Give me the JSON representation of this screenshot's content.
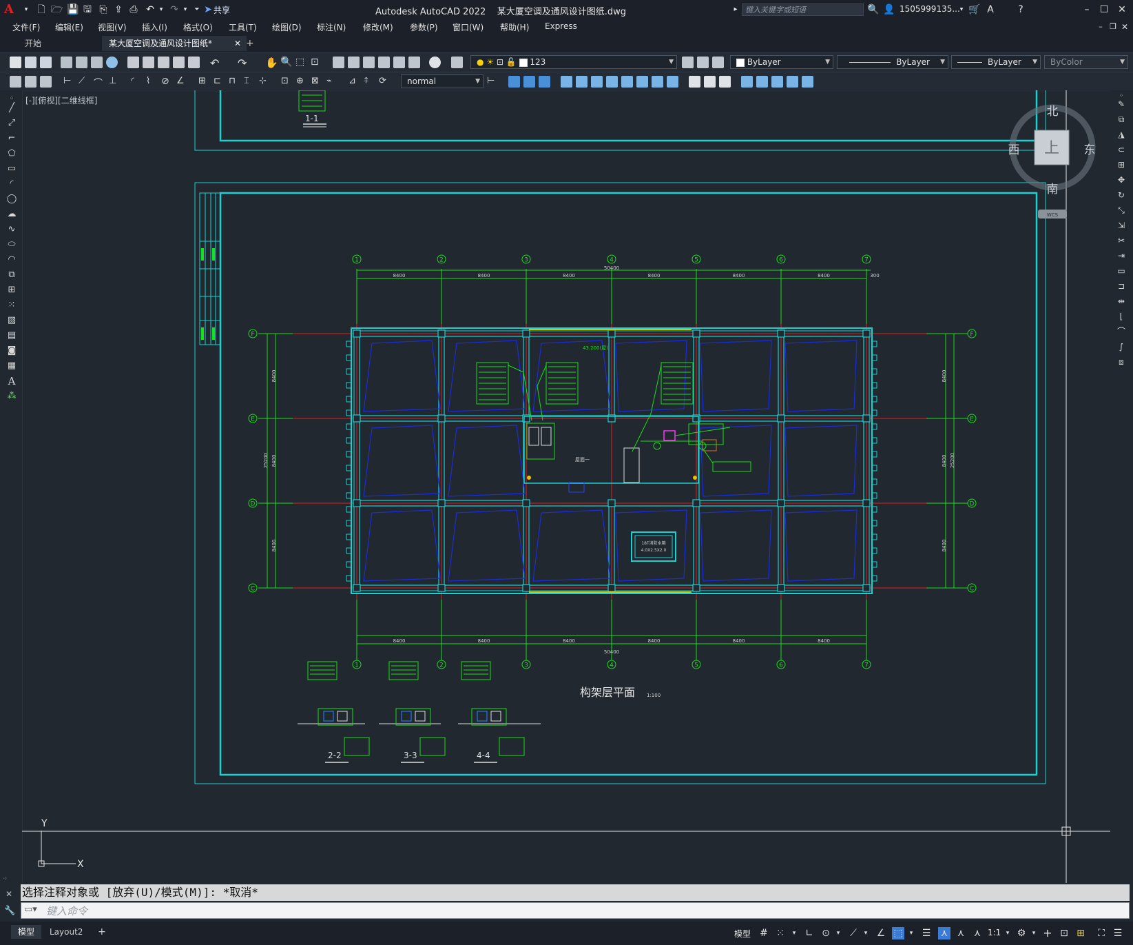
{
  "app": {
    "logo": "A",
    "title": "Autodesk AutoCAD 2022",
    "filename": "某大厦空调及通风设计图纸.dwg",
    "share_label": "共享",
    "search_placeholder": "键入关键字或短语",
    "user": "1505999135...",
    "help": "?"
  },
  "menu": [
    "文件(F)",
    "编辑(E)",
    "视图(V)",
    "插入(I)",
    "格式(O)",
    "工具(T)",
    "绘图(D)",
    "标注(N)",
    "修改(M)",
    "参数(P)",
    "窗口(W)",
    "帮助(H)",
    "Express"
  ],
  "tabs": {
    "start": "开始",
    "doc": "某大厦空调及通风设计图纸*",
    "close": "✕",
    "add": "+"
  },
  "properties": {
    "layer": "123",
    "color": "ByLayer",
    "linetype": "ByLayer",
    "lineweight": "ByLayer",
    "plotstyle": "ByColor",
    "textstyle": "normal"
  },
  "viewport_label": "[-][俯视][二维线框]",
  "viewcube": {
    "north": "北",
    "south": "南",
    "east": "东",
    "west": "西",
    "face": "上",
    "wcs": "WCS"
  },
  "drawing": {
    "title": "构架层平面",
    "scale": "1:100",
    "grid_cols": [
      "1",
      "2",
      "3",
      "4",
      "5",
      "6",
      "7"
    ],
    "grid_rows": [
      "F",
      "E",
      "D",
      "C"
    ],
    "bay_dims": [
      "8400",
      "8400",
      "8400",
      "8400",
      "8400",
      "8400"
    ],
    "total_width": "50400",
    "end_dim": "300",
    "row_dims": [
      "8400",
      "8400",
      "8400"
    ],
    "total_height": "25200",
    "elevation": "43.200(屋)",
    "room_label": "屋面一",
    "tank_label": "18T消防水箱",
    "tank_sub": "4.0X2.5X2.0",
    "section_top": "1-1",
    "sections": [
      "2-2",
      "3-3",
      "4-4"
    ],
    "axes": {
      "y": "Y",
      "x": "X"
    }
  },
  "command": {
    "history": "选择注释对象或 [放弃(U)/模式(M)]: *取消*",
    "placeholder": "键入命令"
  },
  "status": {
    "layouts": [
      "模型",
      "Layout2"
    ],
    "add_layout": "+",
    "model": "模型",
    "scale": "1:1"
  }
}
